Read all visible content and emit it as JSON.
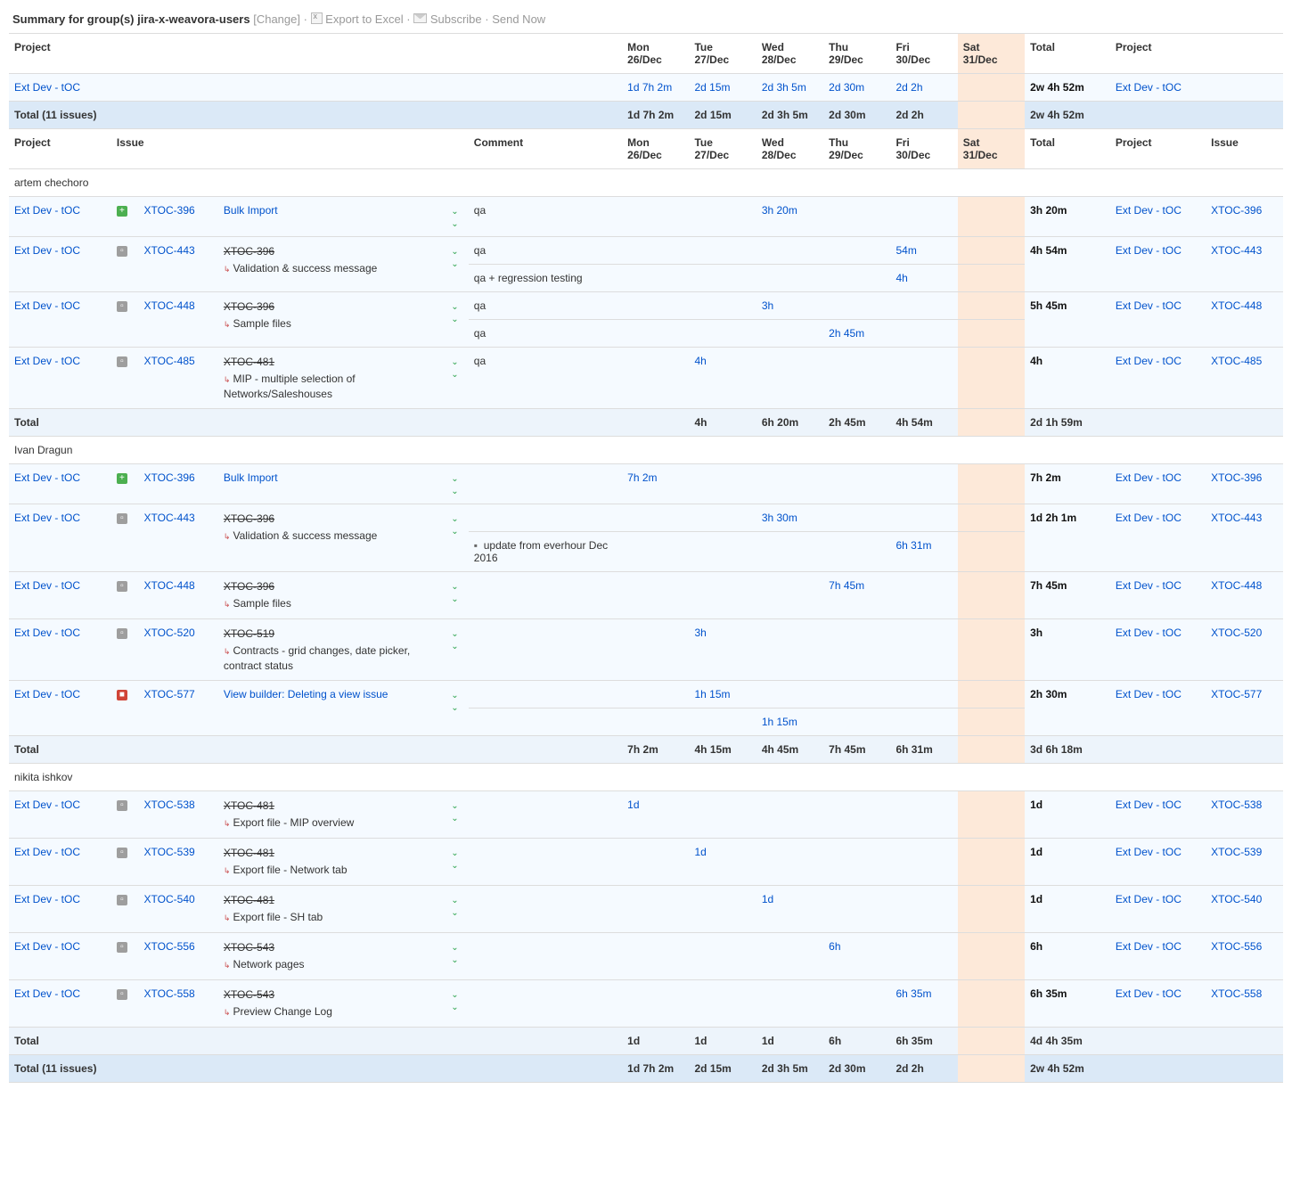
{
  "header": {
    "prefix": "Summary for group(s) ",
    "group": "jira-x-weavora-users",
    "change": "Change",
    "export": "Export to Excel",
    "subscribe": "Subscribe",
    "sendnow": "Send Now"
  },
  "days": {
    "mon": {
      "dow": "Mon",
      "date": "26/Dec"
    },
    "tue": {
      "dow": "Tue",
      "date": "27/Dec"
    },
    "wed": {
      "dow": "Wed",
      "date": "28/Dec"
    },
    "thu": {
      "dow": "Thu",
      "date": "29/Dec"
    },
    "fri": {
      "dow": "Fri",
      "date": "30/Dec"
    },
    "sat": {
      "dow": "Sat",
      "date": "31/Dec"
    }
  },
  "labels": {
    "project": "Project",
    "issue": "Issue",
    "comment": "Comment",
    "total": "Total",
    "totalIssues": "Total (11 issues)",
    "sectionTotal": "Total"
  },
  "projectRow": {
    "name": "Ext Dev - tOC",
    "mon": "1d 7h 2m",
    "tue": "2d 15m",
    "wed": "2d 3h 5m",
    "thu": "2d 30m",
    "fri": "2d 2h",
    "total": "2w 4h 52m"
  },
  "grandRow": {
    "mon": "1d 7h 2m",
    "tue": "2d 15m",
    "wed": "2d 3h 5m",
    "thu": "2d 30m",
    "fri": "2d 2h",
    "total": "2w 4h 52m"
  },
  "sections": {
    "artem": {
      "name": "artem chechoro",
      "rows": {
        "r1": {
          "project": "Ext Dev - tOC",
          "icon": "new",
          "key": "XTOC-396",
          "title": "Bulk Import",
          "comment": "qa",
          "wed": "3h 20m",
          "total": "3h 20m",
          "rkey": "XTOC-396"
        },
        "r2": {
          "project": "Ext Dev - tOC",
          "icon": "sub",
          "key": "XTOC-443",
          "parent": "XTOC-396",
          "sub": "Validation & success message",
          "comment1": "qa",
          "comment2": "qa + regression testing",
          "fri1": "54m",
          "fri2": "4h",
          "total": "4h 54m",
          "rkey": "XTOC-443"
        },
        "r3": {
          "project": "Ext Dev - tOC",
          "icon": "sub",
          "key": "XTOC-448",
          "parent": "XTOC-396",
          "sub": "Sample files",
          "comment1": "qa",
          "comment2": "qa",
          "wed": "3h",
          "thu": "2h 45m",
          "total": "5h 45m",
          "rkey": "XTOC-448"
        },
        "r4": {
          "project": "Ext Dev - tOC",
          "icon": "sub",
          "key": "XTOC-485",
          "parent": "XTOC-481",
          "sub": "MIP - multiple selection of Networks/Saleshouses",
          "comment": "qa",
          "tue": "4h",
          "total": "4h",
          "rkey": "XTOC-485"
        }
      },
      "total": {
        "tue": "4h",
        "wed": "6h 20m",
        "thu": "2h 45m",
        "fri": "4h 54m",
        "total": "2d 1h 59m"
      }
    },
    "ivan": {
      "name": "Ivan Dragun",
      "rows": {
        "r1": {
          "project": "Ext Dev - tOC",
          "icon": "new",
          "key": "XTOC-396",
          "title": "Bulk Import",
          "mon": "7h 2m",
          "total": "7h 2m",
          "rkey": "XTOC-396"
        },
        "r2": {
          "project": "Ext Dev - tOC",
          "icon": "sub",
          "key": "XTOC-443",
          "parent": "XTOC-396",
          "sub": "Validation & success message",
          "comment2p": "update from everhour Dec 2016",
          "bullet": "▪",
          "wed": "3h 30m",
          "fri": "6h 31m",
          "total": "1d 2h 1m",
          "rkey": "XTOC-443"
        },
        "r3": {
          "project": "Ext Dev - tOC",
          "icon": "sub",
          "key": "XTOC-448",
          "parent": "XTOC-396",
          "sub": "Sample files",
          "thu": "7h 45m",
          "total": "7h 45m",
          "rkey": "XTOC-448"
        },
        "r4": {
          "project": "Ext Dev - tOC",
          "icon": "sub",
          "key": "XTOC-520",
          "parent": "XTOC-519",
          "sub": "Contracts - grid changes, date picker, contract status",
          "tue": "3h",
          "total": "3h",
          "rkey": "XTOC-520"
        },
        "r5": {
          "project": "Ext Dev - tOC",
          "icon": "bug",
          "key": "XTOC-577",
          "title": "View builder: Deleting a view issue",
          "tue": "1h 15m",
          "wed": "1h 15m",
          "total": "2h 30m",
          "rkey": "XTOC-577"
        }
      },
      "total": {
        "mon": "7h 2m",
        "tue": "4h 15m",
        "wed": "4h 45m",
        "thu": "7h 45m",
        "fri": "6h 31m",
        "total": "3d 6h 18m"
      }
    },
    "nikita": {
      "name": "nikita ishkov",
      "rows": {
        "r1": {
          "project": "Ext Dev - tOC",
          "icon": "sub",
          "key": "XTOC-538",
          "parent": "XTOC-481",
          "sub": "Export file - MIP overview",
          "mon": "1d",
          "total": "1d",
          "rkey": "XTOC-538"
        },
        "r2": {
          "project": "Ext Dev - tOC",
          "icon": "sub",
          "key": "XTOC-539",
          "parent": "XTOC-481",
          "sub": "Export file - Network tab",
          "tue": "1d",
          "total": "1d",
          "rkey": "XTOC-539"
        },
        "r3": {
          "project": "Ext Dev - tOC",
          "icon": "sub",
          "key": "XTOC-540",
          "parent": "XTOC-481",
          "sub": "Export file - SH tab",
          "wed": "1d",
          "total": "1d",
          "rkey": "XTOC-540"
        },
        "r4": {
          "project": "Ext Dev - tOC",
          "icon": "sub",
          "key": "XTOC-556",
          "parent": "XTOC-543",
          "sub": "Network pages",
          "thu": "6h",
          "total": "6h",
          "rkey": "XTOC-556"
        },
        "r5": {
          "project": "Ext Dev - tOC",
          "icon": "sub",
          "key": "XTOC-558",
          "parent": "XTOC-543",
          "sub": "Preview Change Log",
          "fri": "6h 35m",
          "total": "6h 35m",
          "rkey": "XTOC-558"
        }
      },
      "total": {
        "mon": "1d",
        "tue": "1d",
        "wed": "1d",
        "thu": "6h",
        "fri": "6h 35m",
        "total": "4d 4h 35m"
      }
    }
  }
}
